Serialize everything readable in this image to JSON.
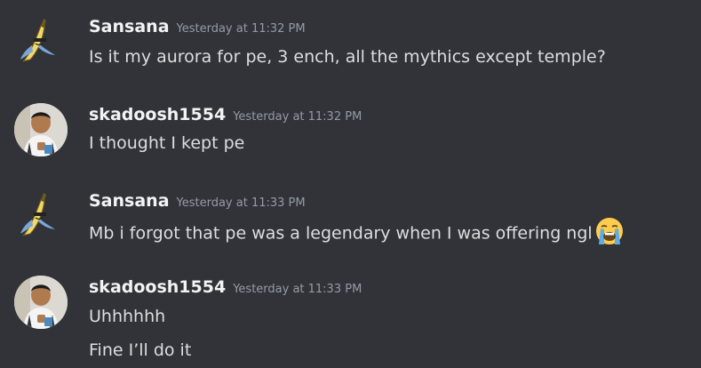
{
  "messages": [
    {
      "username": "Sansana",
      "timestamp": "Yesterday at 11:32 PM",
      "avatar": "banana-avatar",
      "lines": [
        "Is it my aurora for pe, 3 ench,  all the mythics except temple?"
      ]
    },
    {
      "username": "skadoosh1554",
      "timestamp": "Yesterday at 11:32 PM",
      "avatar": "photo-avatar",
      "lines": [
        "I thought I kept pe"
      ]
    },
    {
      "username": "Sansana",
      "timestamp": "Yesterday at 11:33 PM",
      "avatar": "banana-avatar",
      "lines": [
        "Mb i forgot that pe was a legendary when I was offering ngl"
      ],
      "emoji": "loudly-crying-face-emoji"
    },
    {
      "username": "skadoosh1554",
      "timestamp": "Yesterday at 11:33 PM",
      "avatar": "photo-avatar",
      "lines": [
        "Uhhhhhh",
        "Fine I’ll do it"
      ]
    }
  ],
  "colors": {
    "background": "#313338",
    "username": "#f2f3f5",
    "timestamp": "#949ba4",
    "text": "#dbdee1"
  }
}
